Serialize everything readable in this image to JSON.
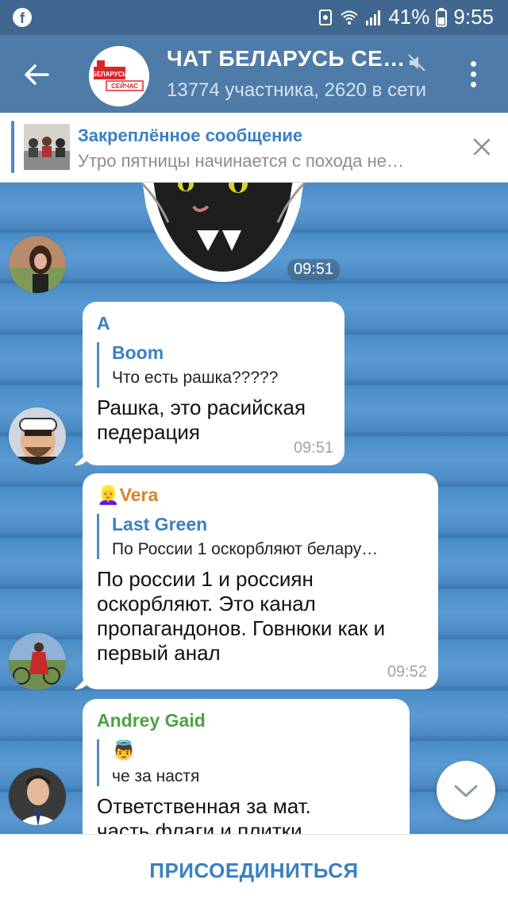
{
  "status_bar": {
    "battery": "41%",
    "time": "9:55",
    "icons": [
      "facebook-icon",
      "recycle-icon",
      "wifi-icon",
      "signal-icon",
      "battery-icon"
    ]
  },
  "header": {
    "title": "ЧАТ БЕЛАРУСЬ СЕ…",
    "subtitle": "13774 участника, 2620 в сети",
    "avatar_text": [
      "БЕЛАРУСЬ",
      "СЕЙЧАС"
    ]
  },
  "pinned": {
    "title": "Закреплённое сообщение",
    "text": "Утро пятницы начинается с похода не…"
  },
  "messages": [
    {
      "time": "09:51"
    },
    {
      "sender": "A",
      "sender_color": "#3a80c3",
      "reply_name": "Boom",
      "reply_text": "Что есть рашка?????",
      "text": "Рашка, это расийская педерация",
      "time": "09:51"
    },
    {
      "sender": "Vera",
      "sender_emoji": "👱‍♀️",
      "sender_color": "#d9822b",
      "reply_name": "Last Green",
      "reply_text": "По России 1 оскорбляют белару…",
      "text": "По россии 1 и россиян оскорбляют. Это канал пропагандонов. Говнюки как и первый анал",
      "time": "09:52"
    },
    {
      "sender": "Andrey Gaid",
      "sender_color": "#4ba33f",
      "reply_emoji": "👼",
      "reply_text": "че за настя",
      "text": "Ответственная за мат.",
      "text_cut": "часть флаги и плитки"
    }
  ],
  "bottom": {
    "join_label": "ПРИСОЕДИНИТЬСЯ"
  }
}
